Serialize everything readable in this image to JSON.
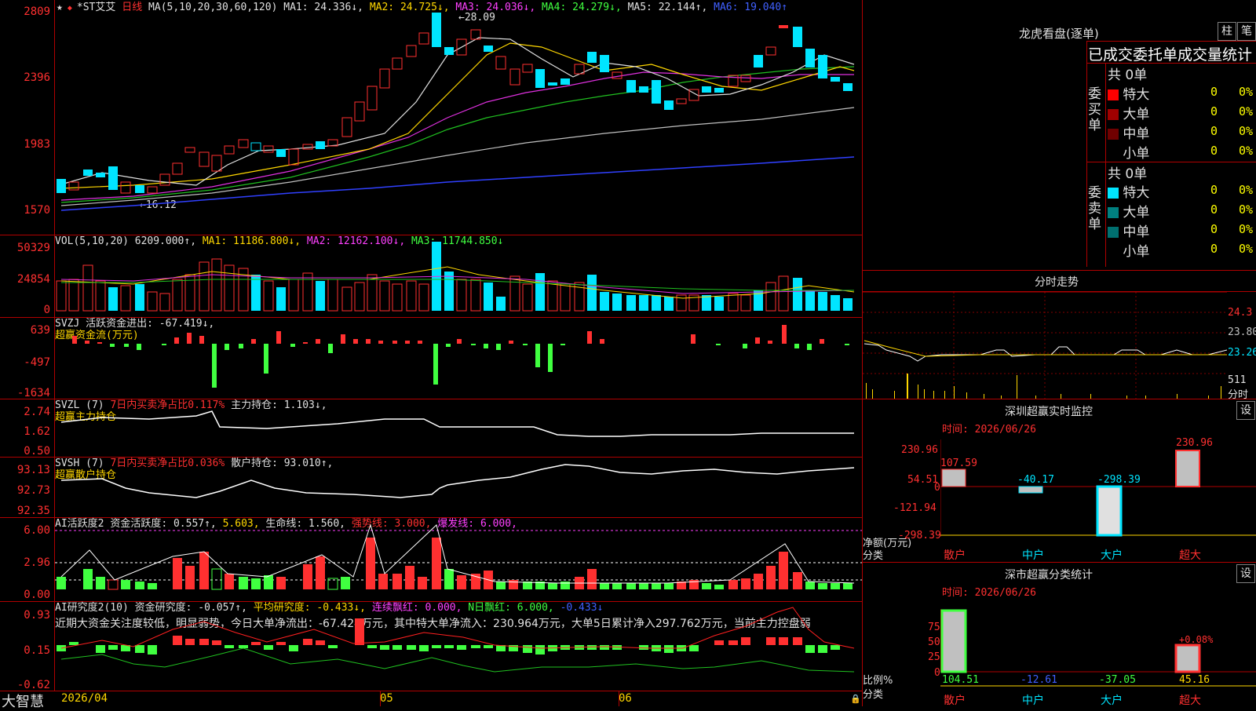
{
  "main": {
    "stock_name": "*ST艾艾",
    "period": "日线",
    "ma_legend": "MA(5,10,20,30,60,120)",
    "ma1": "MA1: 24.336↓,",
    "ma2": "MA2: 24.725↓,",
    "ma3": "MA3: 24.036↓,",
    "ma4": "MA4: 24.279↓,",
    "ma5": "MA5: 22.144↑,",
    "ma6": "MA6: 19.040↑",
    "y_labels": [
      "2809",
      "2396",
      "1983",
      "1570"
    ],
    "high_mark": "28.09",
    "low_mark": "16.12"
  },
  "vol": {
    "legend": "VOL(5,10,20)",
    "value": "6209.000↑,",
    "ma1": "MA1: 11186.800↓,",
    "ma2": "MA2: 12162.100↓,",
    "ma3": "MA3: 11744.850↓",
    "y_labels": [
      "50329",
      "24854",
      "0"
    ]
  },
  "svzj": {
    "legend": "SVZJ",
    "line1": "活跃资金进出: -67.419↓,",
    "line2": "超赢资金流(万元)",
    "y_labels": [
      "639",
      "-497",
      "-1634"
    ]
  },
  "svzl": {
    "legend": "SVZL (7)",
    "ratio": "7日内买卖净占比0.117%",
    "hold": "主力持仓: 1.103↓,",
    "line2": "超赢主力持仓",
    "y_labels": [
      "2.74",
      "1.62",
      "0.50"
    ]
  },
  "svsh": {
    "legend": "SVSH (7)",
    "ratio": "7日内买卖净占比0.036%",
    "hold": "散户持仓: 93.010↑,",
    "line2": "超赢散户持仓",
    "y_labels": [
      "93.13",
      "92.73",
      "92.35"
    ]
  },
  "ai1": {
    "legend": "AI活跃度2",
    "active": "资金活跃度: 0.557↑,",
    "v2": "5.603,",
    "life": "生命线: 1.560,",
    "strong": "强势线: 3.000,",
    "burst": "爆发线: 6.000,",
    "y_labels": [
      "6.00",
      "2.96",
      "0.00"
    ]
  },
  "ai2": {
    "legend": "AI研究度2(10)",
    "research": "资金研究度: -0.057↑,",
    "avg": "平均研究度: -0.433↓,",
    "cont": "连续飘红: 0.000,",
    "nday": "N日飘红: 6.000,",
    "last": "-0.433↓",
    "comment": "近期大资金关注度较低，明显弱势，今日大单净流出：-67.424万元，其中特大单净流入：230.964万元，大单5日累计净入297.762万元，当前主力控盘弱",
    "y_labels": [
      "0.93",
      "0.15",
      "-0.62"
    ]
  },
  "xaxis": {
    "brand": "大智慧",
    "date": "2026/04",
    "m05": "05",
    "m06": "06"
  },
  "right": {
    "title": "龙虎看盘(逐单)",
    "btn_zhu": "柱",
    "btn_bi": "笔",
    "header": "已成交委托单成交量统计",
    "buy_label": "委买单",
    "sell_label": "委卖单",
    "buy_total": "共 0单",
    "sell_total": "共 0单",
    "buy_rows": [
      {
        "label": "特大",
        "color": "#ff0000",
        "v": "0",
        "p": "0%"
      },
      {
        "label": "大单",
        "color": "#a00000",
        "v": "0",
        "p": "0%"
      },
      {
        "label": "中单",
        "color": "#700000",
        "v": "0",
        "p": "0%"
      },
      {
        "label": "小单",
        "color": "#000000",
        "v": "0",
        "p": "0%"
      }
    ],
    "sell_rows": [
      {
        "label": "特大",
        "color": "#00e5ff",
        "v": "0",
        "p": "0%"
      },
      {
        "label": "大单",
        "color": "#008080",
        "v": "0",
        "p": "0%"
      },
      {
        "label": "中单",
        "color": "#007070",
        "v": "0",
        "p": "0%"
      },
      {
        "label": "小单",
        "color": "#000000",
        "v": "0",
        "p": "0%"
      }
    ],
    "intraday_title": "分时走势",
    "intraday_y": [
      "24.3",
      "23.80",
      "23.26"
    ],
    "intraday_vol": "511",
    "intraday_label": "分时",
    "monitor_title": "深圳超赢实时监控",
    "monitor_btn": "设",
    "monitor_time": "时间: 2026/06/26",
    "monitor_y": [
      "230.96",
      "54.51",
      "0",
      "-121.94",
      "-298.39"
    ],
    "monitor_vals": [
      "107.59",
      "-40.17",
      "-298.39",
      "230.96"
    ],
    "monitor_unit1": "净额(万元)",
    "monitor_unit2": "分类",
    "monitor_cats": [
      "散户",
      "中户",
      "大户",
      "超大"
    ],
    "stat_title": "深市超赢分类统计",
    "stat_btn": "设",
    "stat_time": "时间: 2026/06/26",
    "stat_y": [
      "75",
      "50",
      "25",
      "0"
    ],
    "stat_vals": [
      "104.51",
      "-12.61",
      "-37.05",
      "45.16"
    ],
    "stat_note": "+0.08%",
    "stat_unit1": "比例%",
    "stat_unit2": "分类",
    "stat_cats": [
      "散户",
      "中户",
      "大户",
      "超大"
    ]
  }
}
